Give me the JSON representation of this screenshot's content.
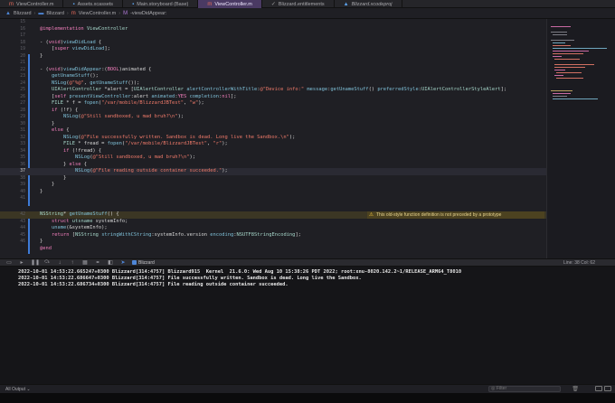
{
  "tabs": [
    {
      "label": "ViewController.m",
      "icon": "objc-file-icon",
      "active": false
    },
    {
      "label": "Assets.xcassets",
      "icon": "assets-folder-icon",
      "active": false
    },
    {
      "label": "Main.storyboard (Base)",
      "icon": "storyboard-icon",
      "active": false
    },
    {
      "label": "ViewController.m",
      "icon": "objc-file-icon",
      "active": true
    },
    {
      "label": "Blizzard.entitlements",
      "icon": "entitlements-icon",
      "active": false
    },
    {
      "label": "Blizzard.xcodeproj",
      "icon": "xcodeproj-icon",
      "active": false
    }
  ],
  "breadcrumb": {
    "project": "Blizzard",
    "folder": "Blizzard",
    "file": "ViewController.m",
    "method": "-viewDidAppear:"
  },
  "editor": {
    "line_numbers": [
      "15",
      "16",
      "17",
      "18",
      "19",
      "20",
      "21",
      "22",
      "23",
      "24",
      "25",
      "26",
      "27",
      "28",
      "29",
      "30",
      "31",
      "32",
      "33",
      "34",
      "35",
      "36",
      "37",
      "38",
      "39",
      "40",
      "41",
      "42",
      "43",
      "44",
      "45",
      "46"
    ],
    "warning": "This old-style function definition is not preceded by a prototype",
    "current_line": "36"
  },
  "debug": {
    "target": "Blizzard",
    "line_col": "Line: 38  Col: 62"
  },
  "console": {
    "lines": [
      "2022-10-01 14:53:22.665247+0300 Blizzard[314:4757] Blizzard915  Kernel  21.6.0: Wed Aug 10 15:38:26 PDT 2022; root:xnu-8020.142.2~1/RELEASE_ARM64_T8010",
      "2022-10-01 14:53:22.686647+0300 Blizzard[314:4757] File successfully written. Sandbox is dead. Long live the Sandbox.",
      "2022-10-01 14:53:22.686734+0300 Blizzard[314:4757] File reading outside container succeeded."
    ]
  },
  "bottom": {
    "output_selector": "All Output",
    "filter_placeholder": "Filter"
  },
  "colors": {
    "active_tab": "#4a3a63",
    "keyword": "#f37fbd",
    "string": "#f07a6a",
    "warning_bg": "#4c4220"
  }
}
